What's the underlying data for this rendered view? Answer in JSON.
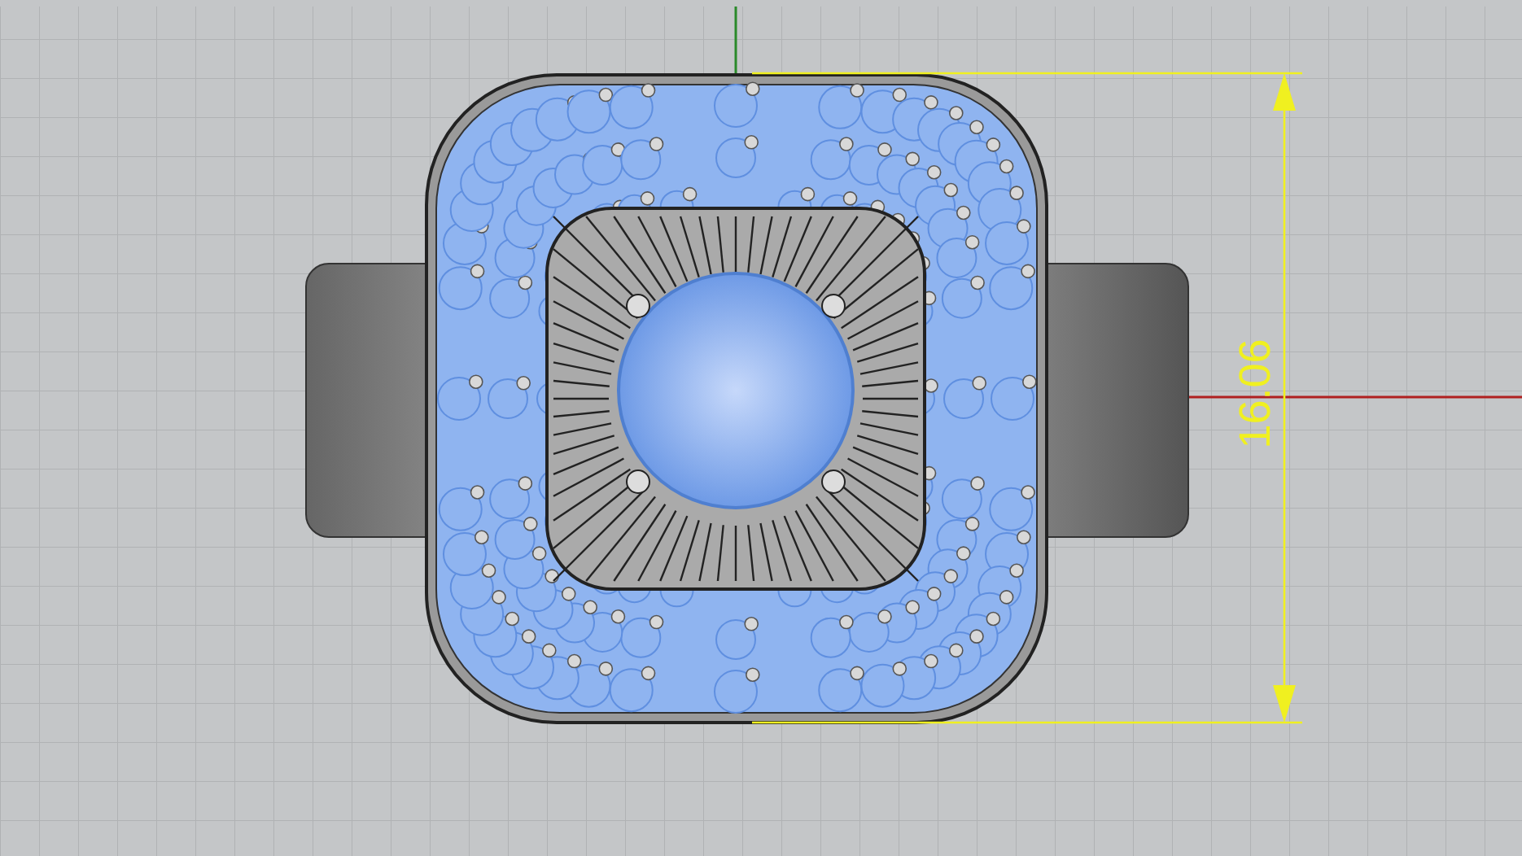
{
  "viewport": {
    "dimension": {
      "text": "16.06"
    }
  }
}
